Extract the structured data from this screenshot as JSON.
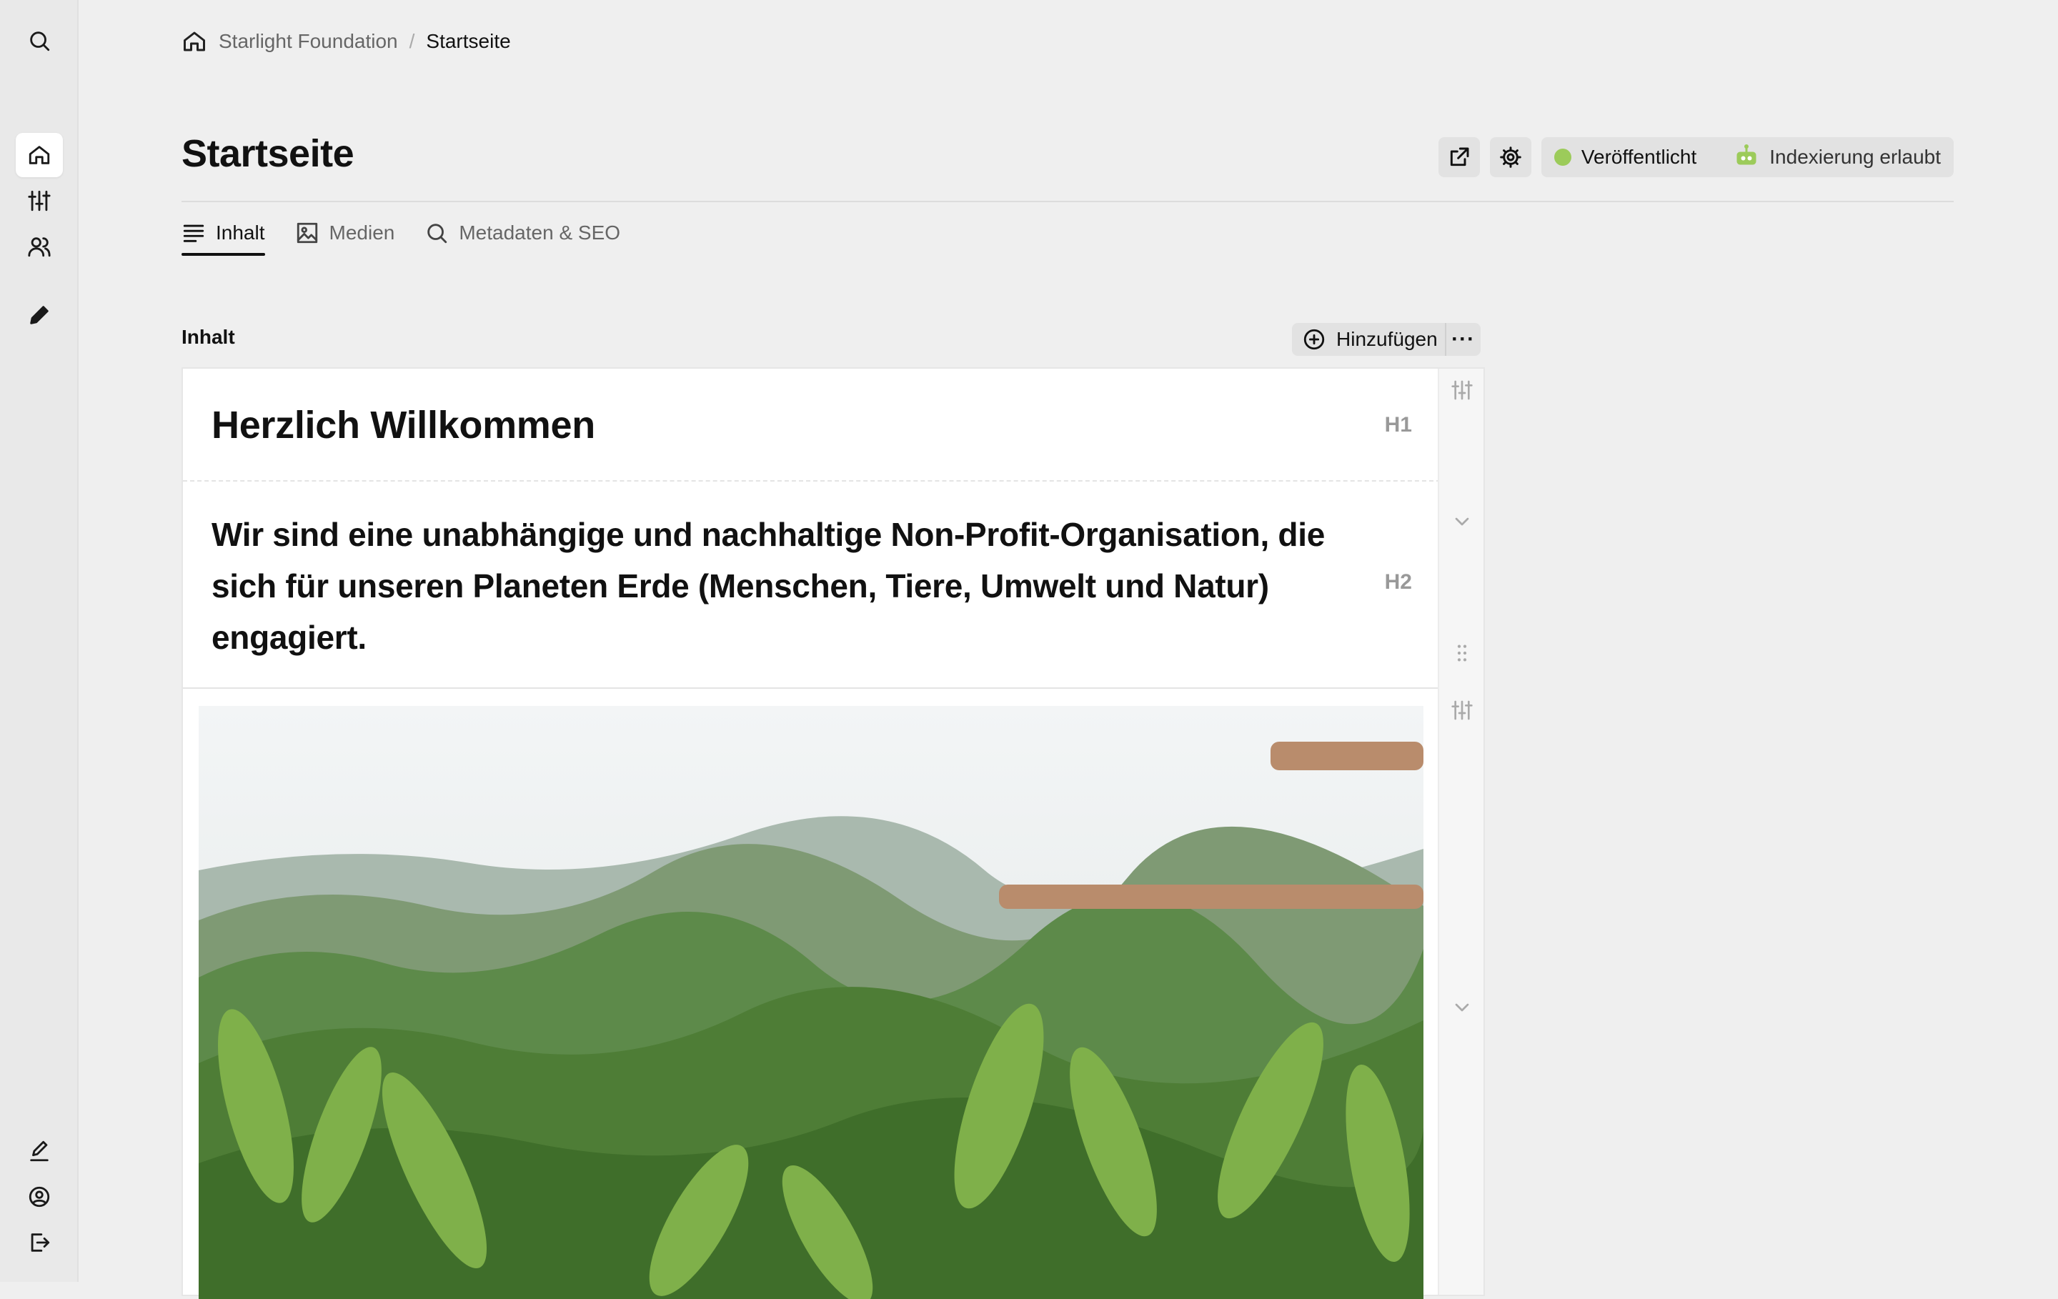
{
  "breadcrumb": {
    "root": "Starlight Foundation",
    "separator": "/",
    "current": "Startseite"
  },
  "page": {
    "title": "Startseite"
  },
  "status": {
    "published": "Veröffentlicht",
    "indexing": "Indexierung erlaubt",
    "published_color": "#9ccb5a"
  },
  "tabs": [
    {
      "label": "Inhalt",
      "icon": "text-lines-icon"
    },
    {
      "label": "Medien",
      "icon": "image-icon"
    },
    {
      "label": "Metadaten & SEO",
      "icon": "search-icon"
    }
  ],
  "content": {
    "label": "Inhalt",
    "add_label": "Hinzufügen",
    "more_label": "···",
    "blocks": [
      {
        "type": "H1",
        "text": "Herzlich Willkommen"
      },
      {
        "type": "H2",
        "text": "Wir sind eine unabhängige und nachhaltige Non-Profit-Organisation, die sich für unseren Planeten Erde (Menschen, Tiere, Umwelt und Natur) engagiert."
      },
      {
        "type": "image",
        "description": "jungle-photo"
      }
    ]
  }
}
